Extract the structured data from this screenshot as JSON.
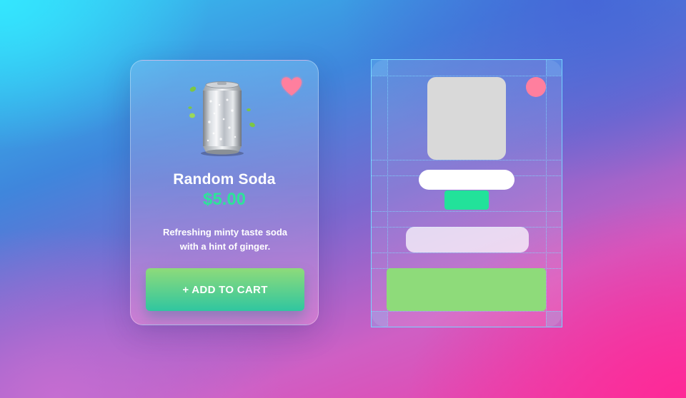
{
  "product": {
    "name": "Random Soda",
    "price": "$5.00",
    "description": "Refreshing minty taste soda with a hint of ginger.",
    "cart_button_label": "+ ADD TO CART",
    "favorite_icon": "heart-icon",
    "image": "soda-can"
  },
  "colors": {
    "price": "#2ee39a",
    "heart": "#ff7f9e",
    "button_top": "#8edb7a",
    "button_bottom": "#30c6a0",
    "guide_lines": "#7fd9ff",
    "image_placeholder": "#d9d9d9"
  }
}
